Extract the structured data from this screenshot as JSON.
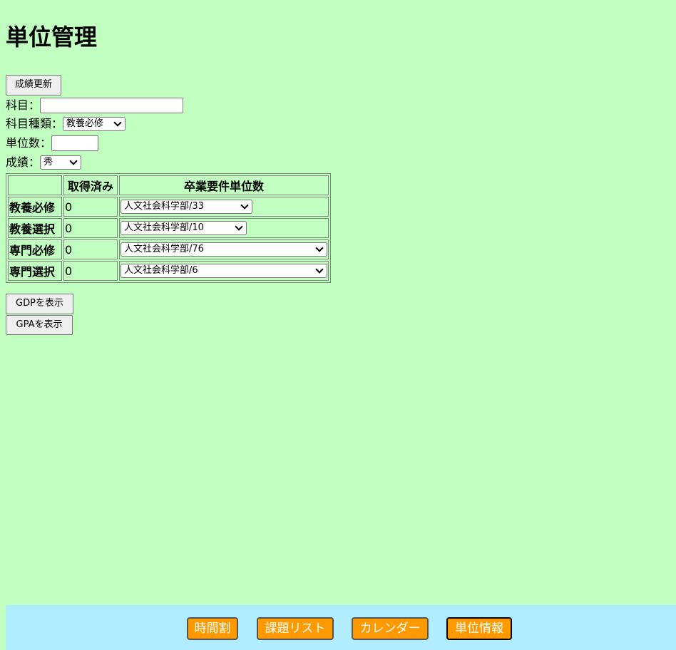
{
  "page_title": "単位管理",
  "update_button": "成績更新",
  "form": {
    "subject_label": "科目：",
    "subject_value": "",
    "type_label": "科目種類：",
    "type_selected": "教養必修",
    "credits_label": "単位数：",
    "credits_value": "",
    "grade_label": "成績：",
    "grade_selected": "秀"
  },
  "table": {
    "headers": [
      "",
      "取得済み",
      "卒業要件単位数"
    ],
    "rows": [
      {
        "category": "教養必修",
        "earned": "0",
        "requirement": "人文社会科学部/33"
      },
      {
        "category": "教養選択",
        "earned": "0",
        "requirement": "人文社会科学部/10"
      },
      {
        "category": "専門必修",
        "earned": "0",
        "requirement": "人文社会科学部/76"
      },
      {
        "category": "専門選択",
        "earned": "0",
        "requirement": "人文社会科学部/6"
      }
    ]
  },
  "gdp_button": "GDPを表示",
  "gpa_button": "GPAを表示",
  "nav": {
    "timetable": "時間割",
    "tasks": "課題リスト",
    "calendar": "カレンダー",
    "credits": "単位情報"
  },
  "colors": {
    "page_background": "#c0ffc0",
    "footer_background": "#b0eeff",
    "nav_button": "#ff9900"
  }
}
